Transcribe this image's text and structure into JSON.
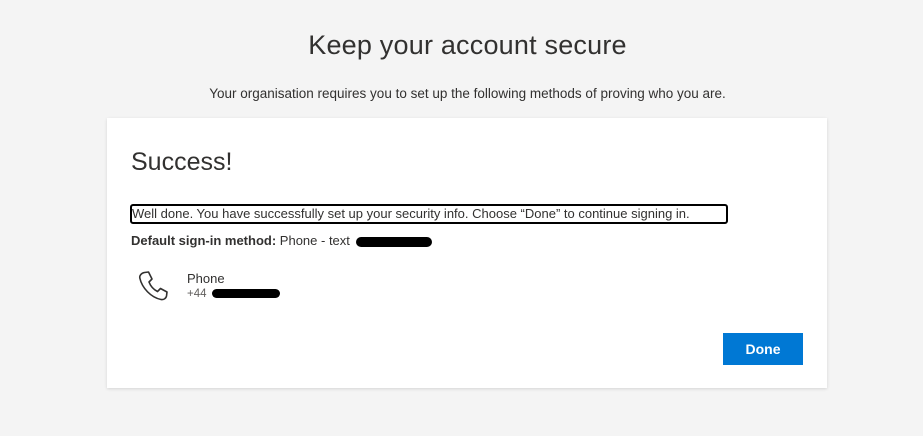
{
  "page": {
    "title": "Keep your account secure",
    "subtitle": "Your organisation requires you to set up the following methods of proving who you are."
  },
  "card": {
    "title": "Success!",
    "message": "Well done. You have successfully set up your security info. Choose “Done” to continue signing in.",
    "default_method_label": "Default sign-in method:",
    "default_method_value": "Phone - text",
    "method": {
      "icon": "phone-icon",
      "name": "Phone",
      "number_prefix": "+44"
    },
    "done_label": "Done"
  },
  "colors": {
    "accent": "#0078d4",
    "background": "#f4f4f4",
    "card": "#ffffff",
    "text": "#323130"
  }
}
